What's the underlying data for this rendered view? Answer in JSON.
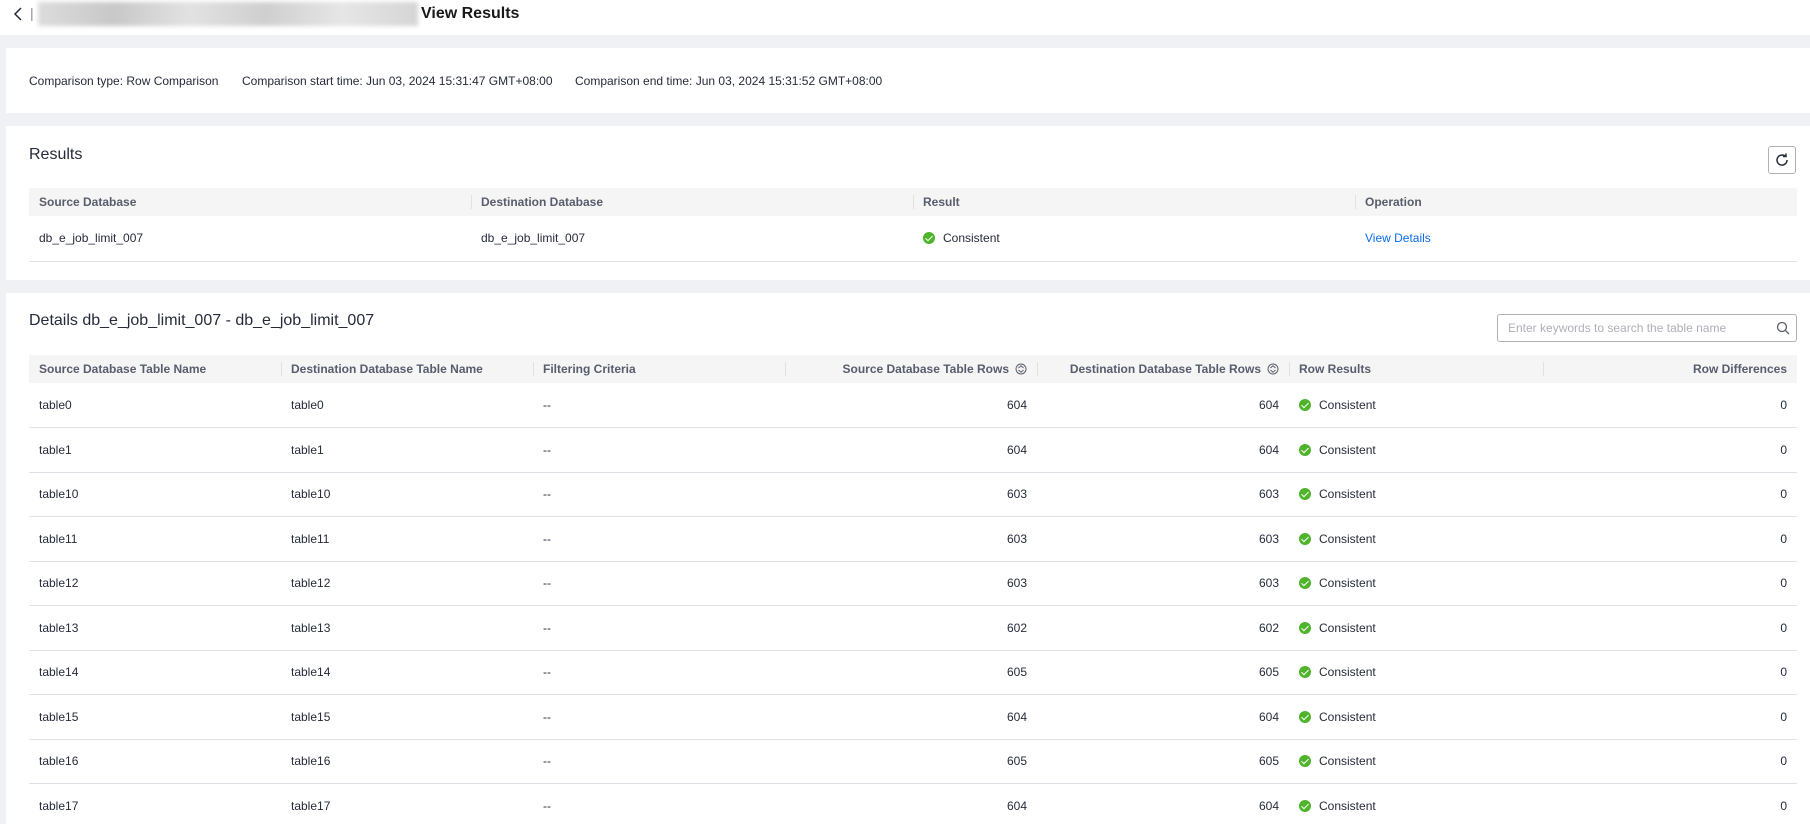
{
  "header": {
    "title": "View Results",
    "separator": "|"
  },
  "summary": {
    "type_label": "Comparison type: Row Comparison",
    "start_label": "Comparison start time: Jun 03, 2024 15:31:47 GMT+08:00",
    "end_label": "Comparison end time: Jun 03, 2024 15:31:52 GMT+08:00"
  },
  "results": {
    "title": "Results",
    "columns": [
      "Source Database",
      "Destination Database",
      "Result",
      "Operation"
    ],
    "row": {
      "source": "db_e_job_limit_007",
      "destination": "db_e_job_limit_007",
      "result": "Consistent",
      "operation": "View Details"
    }
  },
  "details": {
    "title": "Details db_e_job_limit_007 - db_e_job_limit_007",
    "search_placeholder": "Enter keywords to search the table name",
    "columns": [
      "Source Database Table Name",
      "Destination Database Table Name",
      "Filtering Criteria",
      "Source Database Table Rows",
      "Destination Database Table Rows",
      "Row Results",
      "Row Differences"
    ],
    "rows": [
      {
        "src": "table0",
        "dst": "table0",
        "filter": "--",
        "src_rows": "604",
        "dst_rows": "604",
        "result": "Consistent",
        "diff": "0"
      },
      {
        "src": "table1",
        "dst": "table1",
        "filter": "--",
        "src_rows": "604",
        "dst_rows": "604",
        "result": "Consistent",
        "diff": "0"
      },
      {
        "src": "table10",
        "dst": "table10",
        "filter": "--",
        "src_rows": "603",
        "dst_rows": "603",
        "result": "Consistent",
        "diff": "0"
      },
      {
        "src": "table11",
        "dst": "table11",
        "filter": "--",
        "src_rows": "603",
        "dst_rows": "603",
        "result": "Consistent",
        "diff": "0"
      },
      {
        "src": "table12",
        "dst": "table12",
        "filter": "--",
        "src_rows": "603",
        "dst_rows": "603",
        "result": "Consistent",
        "diff": "0"
      },
      {
        "src": "table13",
        "dst": "table13",
        "filter": "--",
        "src_rows": "602",
        "dst_rows": "602",
        "result": "Consistent",
        "diff": "0"
      },
      {
        "src": "table14",
        "dst": "table14",
        "filter": "--",
        "src_rows": "605",
        "dst_rows": "605",
        "result": "Consistent",
        "diff": "0"
      },
      {
        "src": "table15",
        "dst": "table15",
        "filter": "--",
        "src_rows": "604",
        "dst_rows": "604",
        "result": "Consistent",
        "diff": "0"
      },
      {
        "src": "table16",
        "dst": "table16",
        "filter": "--",
        "src_rows": "605",
        "dst_rows": "605",
        "result": "Consistent",
        "diff": "0"
      },
      {
        "src": "table17",
        "dst": "table17",
        "filter": "--",
        "src_rows": "604",
        "dst_rows": "604",
        "result": "Consistent",
        "diff": "0"
      }
    ]
  },
  "colors": {
    "success": "#50b32c",
    "link": "#0a6ef2"
  }
}
